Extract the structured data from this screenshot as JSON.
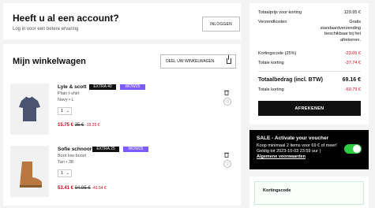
{
  "account": {
    "title": "Heeft u al een account?",
    "subtitle": "Log in voor een betere ervaring",
    "login_label": "INLOGGEN"
  },
  "cart": {
    "title": "Mijn winkelwagen",
    "share_label": "DEEL UW WINKELWAGEN",
    "items": [
      {
        "brand": "Lyle & scott",
        "badges": [
          "EXTRA 40",
          "WOW25"
        ],
        "name": "Plain t-shirt",
        "variant": "Navy  •  L",
        "qty": "1",
        "price_now": "15.75 €",
        "price_old": "35 €",
        "saving": "-19.25 €"
      },
      {
        "brand": "Sofie schnoor",
        "badges": [
          "EXTRA 25",
          "WOW25"
        ],
        "name": "Boot low boozt",
        "variant": "Tan  •  38",
        "qty": "1",
        "price_now": "53.41 €",
        "price_old": "94.95 €",
        "saving": "-41.54 €"
      }
    ]
  },
  "summary": {
    "rows": [
      {
        "label": "Totaalprijs voor korting",
        "value": "129.95 €"
      },
      {
        "label": "Verzendkosten",
        "value": "Gratis standaardverzending beschikbaar bij het afrekenen."
      },
      {
        "label": "Kortingscode (25%)",
        "value": "-23.05 €"
      },
      {
        "label": "Totale korting",
        "value": "-37.74 €"
      }
    ],
    "total_label": "Totaalbedrag (incl. BTW)",
    "total_value": "69.16 €",
    "total_discount_label": "Totale korting",
    "total_discount_value": "-60.79 €",
    "checkout_label": "AFREKENEN"
  },
  "voucher": {
    "title": "SALE - Activate your voucher",
    "description": "Koop minimaal 2 items voor 69 € of meer! Geldig tot 2023-10-03 23:59 uur |",
    "terms_link": "Algemene voorwaarden",
    "toggle_on": true
  },
  "code": {
    "label": "Kortingscode"
  },
  "colors": {
    "accent_red": "#d0021b",
    "badge_purple": "#7c5cff",
    "toggle_green": "#2ecc40"
  }
}
